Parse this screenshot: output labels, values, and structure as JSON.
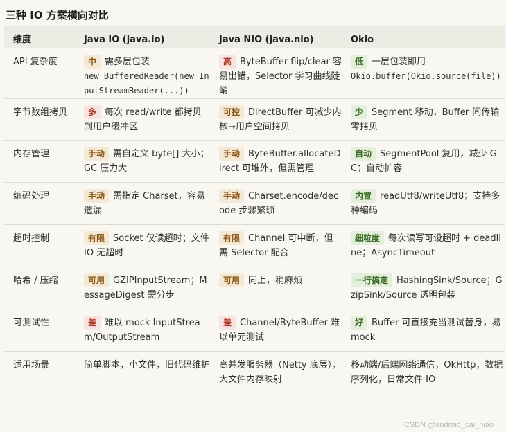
{
  "title": "三种 IO 方案横向对比",
  "headers": [
    "维度",
    "Java IO (java.io)",
    "Java NIO (java.nio)",
    "Okio"
  ],
  "rows": [
    {
      "dimension": "API 复杂度",
      "io": {
        "badge": "中",
        "tone": "orange",
        "text": "需多层包装",
        "code": "new BufferedReader(new InputStreamReader(...))"
      },
      "nio": {
        "badge": "高",
        "tone": "red",
        "text": "ByteBuffer flip/clear 容易出错，Selector 学习曲线陡峭"
      },
      "okio": {
        "badge": "低",
        "tone": "green",
        "text": "一层包装即用",
        "code": "Okio.buffer(Okio.source(file))"
      }
    },
    {
      "dimension": "字节数组拷贝",
      "io": {
        "badge": "多",
        "tone": "red",
        "text": "每次 read/write 都拷贝到用户缓冲区"
      },
      "nio": {
        "badge": "可控",
        "tone": "orange",
        "text": "DirectBuffer 可减少内核→用户空间拷贝"
      },
      "okio": {
        "badge": "少",
        "tone": "green",
        "text": "Segment 移动，Buffer 间传输零拷贝"
      }
    },
    {
      "dimension": "内存管理",
      "io": {
        "badge": "手动",
        "tone": "orange",
        "text": "需自定义 byte[] 大小；GC 压力大"
      },
      "nio": {
        "badge": "手动",
        "tone": "orange",
        "text": "ByteBuffer.allocateDirect 可堆外，但需管理"
      },
      "okio": {
        "badge": "自动",
        "tone": "green",
        "text": "SegmentPool 复用，减少 GC；自动扩容"
      }
    },
    {
      "dimension": "编码处理",
      "io": {
        "badge": "手动",
        "tone": "orange",
        "text": "需指定 Charset，容易遗漏"
      },
      "nio": {
        "badge": "手动",
        "tone": "orange",
        "text": "Charset.encode/decode 步骤繁琐"
      },
      "okio": {
        "badge": "内置",
        "tone": "green",
        "text": "readUtf8/writeUtf8；支持多种编码"
      }
    },
    {
      "dimension": "超时控制",
      "io": {
        "badge": "有限",
        "tone": "orange",
        "text": "Socket 仅读超时；文件 IO 无超时"
      },
      "nio": {
        "badge": "有限",
        "tone": "orange",
        "text": "Channel 可中断，但需 Selector 配合"
      },
      "okio": {
        "badge": "细粒度",
        "tone": "green",
        "text": "每次读写可设超时 + deadline；AsyncTimeout"
      }
    },
    {
      "dimension": "哈希 / 压缩",
      "io": {
        "badge": "可用",
        "tone": "orange",
        "text": "GZIPInputStream；MessageDigest 需分步"
      },
      "nio": {
        "badge": "可用",
        "tone": "orange",
        "text": "同上，稍麻烦"
      },
      "okio": {
        "badge": "一行搞定",
        "tone": "green",
        "text": "HashingSink/Source；GzipSink/Source 透明包装"
      }
    },
    {
      "dimension": "可测试性",
      "io": {
        "badge": "差",
        "tone": "red",
        "text": "难以 mock InputStream/OutputStream"
      },
      "nio": {
        "badge": "差",
        "tone": "red",
        "text": "Channel/ByteBuffer 难以单元测试"
      },
      "okio": {
        "badge": "好",
        "tone": "green",
        "text": "Buffer 可直接充当测试替身，易 mock"
      }
    },
    {
      "dimension": "适用场景",
      "io": {
        "badge": "",
        "tone": "",
        "text": "简单脚本，小文件，旧代码维护"
      },
      "nio": {
        "badge": "",
        "tone": "",
        "text": "高并发服务器（Netty 底层），大文件内存映射"
      },
      "okio": {
        "badge": "",
        "tone": "",
        "text": "移动端/后端网络通信，OkHttp，数据序列化，日常文件 IO"
      }
    }
  ],
  "watermark": "CSDN @android_cai_niao"
}
